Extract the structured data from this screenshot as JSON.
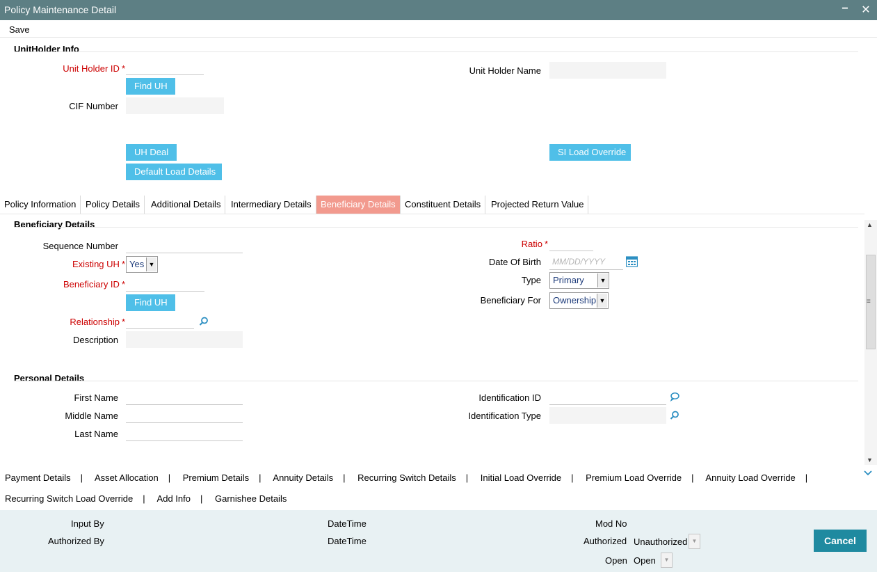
{
  "window": {
    "title": "Policy Maintenance Detail",
    "minimize": "−",
    "close": "✕"
  },
  "toolbar": {
    "save_label": "Save"
  },
  "unitholder": {
    "section_title": "UnitHolder Info",
    "unit_holder_id_label": "Unit Holder ID",
    "unit_holder_id_value": "",
    "unit_holder_name_label": "Unit Holder Name",
    "unit_holder_name_value": "",
    "find_uh_label": "Find UH",
    "cif_label": "CIF Number",
    "cif_value": "",
    "uh_deal_label": "UH Deal",
    "default_load_label": "Default Load Details",
    "si_load_override_label": "SI Load Override"
  },
  "tabs": [
    {
      "label": "Policy Information",
      "active": false
    },
    {
      "label": "Policy Details",
      "active": false
    },
    {
      "label": "Additional Details",
      "active": false
    },
    {
      "label": "Intermediary Details",
      "active": false
    },
    {
      "label": "Beneficiary Details",
      "active": true
    },
    {
      "label": "Constituent Details",
      "active": false
    },
    {
      "label": "Projected Return Value",
      "active": false
    }
  ],
  "beneficiary": {
    "section_title": "Beneficiary Details",
    "sequence_label": "Sequence Number",
    "sequence_value": "",
    "existing_uh_label": "Existing UH",
    "existing_uh_value": "Yes",
    "beneficiary_id_label": "Beneficiary ID",
    "beneficiary_id_value": "",
    "find_uh_label": "Find UH",
    "relationship_label": "Relationship",
    "relationship_value": "",
    "description_label": "Description",
    "description_value": "",
    "ratio_label": "Ratio",
    "ratio_value": "",
    "dob_label": "Date Of Birth",
    "dob_placeholder": "MM/DD/YYYY",
    "type_label": "Type",
    "type_value": "Primary",
    "beneficiary_for_label": "Beneficiary For",
    "beneficiary_for_value": "Ownership"
  },
  "personal": {
    "section_title": "Personal Details",
    "first_name_label": "First Name",
    "middle_name_label": "Middle Name",
    "last_name_label": "Last Name",
    "identification_id_label": "Identification ID",
    "identification_type_label": "Identification Type"
  },
  "bottom_links": {
    "row1": [
      "Payment Details",
      "Asset Allocation",
      "Premium Details",
      "Annuity Details",
      "Recurring Switch Details",
      "Initial Load Override",
      "Premium Load Override",
      "Annuity Load Override"
    ],
    "row2": [
      "Recurring Switch Load Override",
      "Add Info",
      "Garnishee Details"
    ],
    "separator": "|"
  },
  "footer": {
    "input_by_label": "Input By",
    "authorized_by_label": "Authorized By",
    "datetime_label_1": "DateTime",
    "datetime_label_2": "DateTime",
    "mod_no_label": "Mod No",
    "authorized_label": "Authorized",
    "authorized_value": "Unauthorized",
    "open_label": "Open",
    "open_value": "Open",
    "cancel_label": "Cancel"
  },
  "colors": {
    "titlebar": "#5d7f84",
    "button": "#4fbfe8",
    "active_tab": "#f29a8e",
    "required": "#cc0000",
    "cancel": "#1f8aa0",
    "footer": "#e8f1f3"
  },
  "icons": [
    "minimize-icon",
    "close-icon",
    "calendar-icon",
    "search-icon",
    "comment-icon",
    "chevron-down-icon"
  ]
}
